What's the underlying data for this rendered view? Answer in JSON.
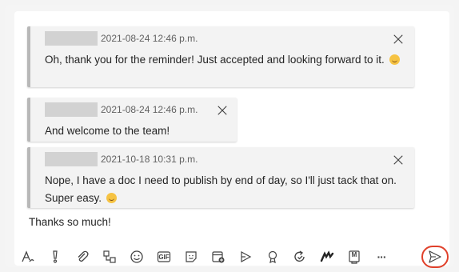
{
  "quotes": [
    {
      "timestamp": "2021-08-24 12:46 p.m.",
      "text": "Oh, thank you for the reminder! Just accepted and looking forward to it.",
      "emoji": "smile"
    },
    {
      "timestamp": "2021-08-24 12:46 p.m.",
      "text": "And welcome to the team!"
    },
    {
      "timestamp": "2021-10-18 10:31 p.m.",
      "text": "Nope, I have a doc I need to publish by end of day, so I'll just tack that on. Super easy.",
      "emoji": "relieved"
    }
  ],
  "reply": {
    "text": "Thanks so much!"
  },
  "toolbar": {
    "icons": [
      "format-icon",
      "important-icon",
      "attach-icon",
      "loop-icon",
      "emoji-icon",
      "gif-icon",
      "sticker-icon",
      "schedule-meeting-icon",
      "stream-icon",
      "praise-icon",
      "approvals-icon",
      "viva-icon",
      "meeting-notes-icon",
      "more-options-icon",
      "send-icon"
    ],
    "gif_label": "GIF",
    "more_label": "···",
    "m_label": "M"
  },
  "colors": {
    "send_highlight": "#e0402a",
    "quote_bar": "#b8b8b8",
    "quote_bg": "#f3f3f3"
  }
}
